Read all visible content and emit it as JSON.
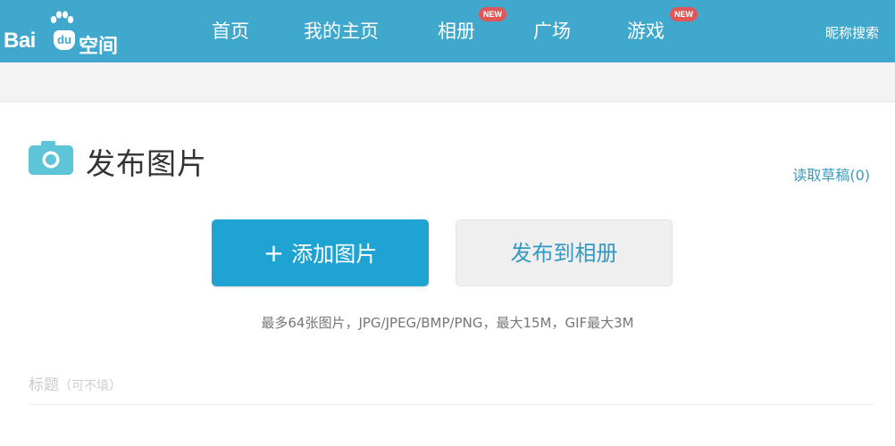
{
  "header": {
    "logo": {
      "bai": "Bai",
      "du": "du",
      "kongjian": "空间"
    },
    "nav": [
      {
        "label": "首页",
        "badge": ""
      },
      {
        "label": "我的主页",
        "badge": ""
      },
      {
        "label": "相册",
        "badge": "NEW"
      },
      {
        "label": "广场",
        "badge": ""
      },
      {
        "label": "游戏",
        "badge": "NEW"
      }
    ],
    "nick_search": "昵称搜索"
  },
  "main": {
    "page_title": "发布图片",
    "draft_link": "读取草稿(0)",
    "add_button": {
      "plus": "+",
      "label": "添加图片"
    },
    "publish_button": "发布到相册",
    "hint": "最多64张图片，JPG/JPEG/BMP/PNG，最大15M，GIF最大3M",
    "title_field": {
      "label": "标题",
      "optional": "（可不填）"
    }
  },
  "colors": {
    "header_bg": "#3fa8cc",
    "primary_button": "#1ea3d3",
    "link": "#3a9bbf",
    "badge": "#e15757",
    "camera_icon": "#5ec4d8"
  }
}
